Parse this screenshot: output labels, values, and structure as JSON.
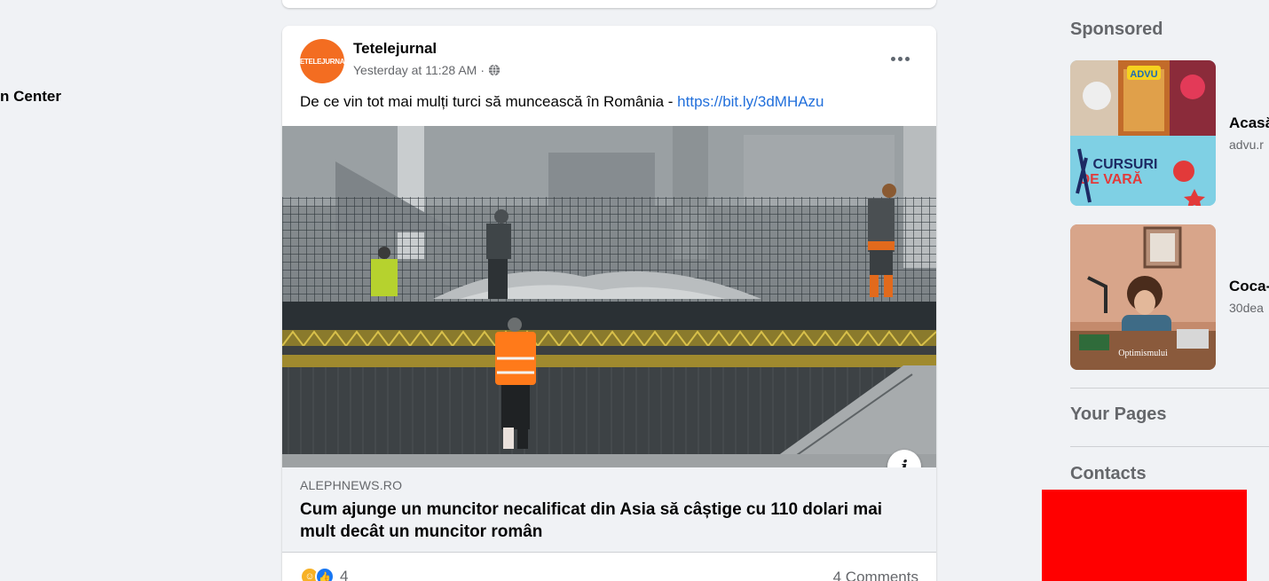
{
  "left_nav": {
    "partial_item": "n Center"
  },
  "post": {
    "author": "Tetelejurnal",
    "avatar_text": "TETELEJURNAL",
    "timestamp": "Yesterday at 11:28 AM",
    "separator": "·",
    "audience_icon": "globe-icon",
    "text": "De ce vin tot mai mulți turci să muncească în România - ",
    "link": "https://bit.ly/3dMHAzu",
    "info_glyph": "i",
    "preview": {
      "domain": "ALEPHNEWS.RO",
      "title": "Cum ajunge un muncitor necalificat din Asia să câștige cu 110 dolari mai mult decât un muncitor român"
    },
    "reaction_count": "4",
    "comments": "4 Comments"
  },
  "sidebar": {
    "sponsored_heading": "Sponsored",
    "ads": [
      {
        "title": "Acasă",
        "domain": "advu.r"
      },
      {
        "title": "Coca-",
        "domain": "30dea"
      }
    ],
    "ad1_logo": "ADVU",
    "ad1_banner_line1": "CURSURI",
    "ad1_banner_line2": "DE VARĂ",
    "ad2_caption": "Optimismului",
    "your_pages_heading": "Your Pages",
    "contacts_heading": "Contacts"
  },
  "colors": {
    "accent_link": "#216fdb",
    "avatar": "#f36d21",
    "redaction": "#ff0000",
    "background": "#f0f2f5"
  }
}
